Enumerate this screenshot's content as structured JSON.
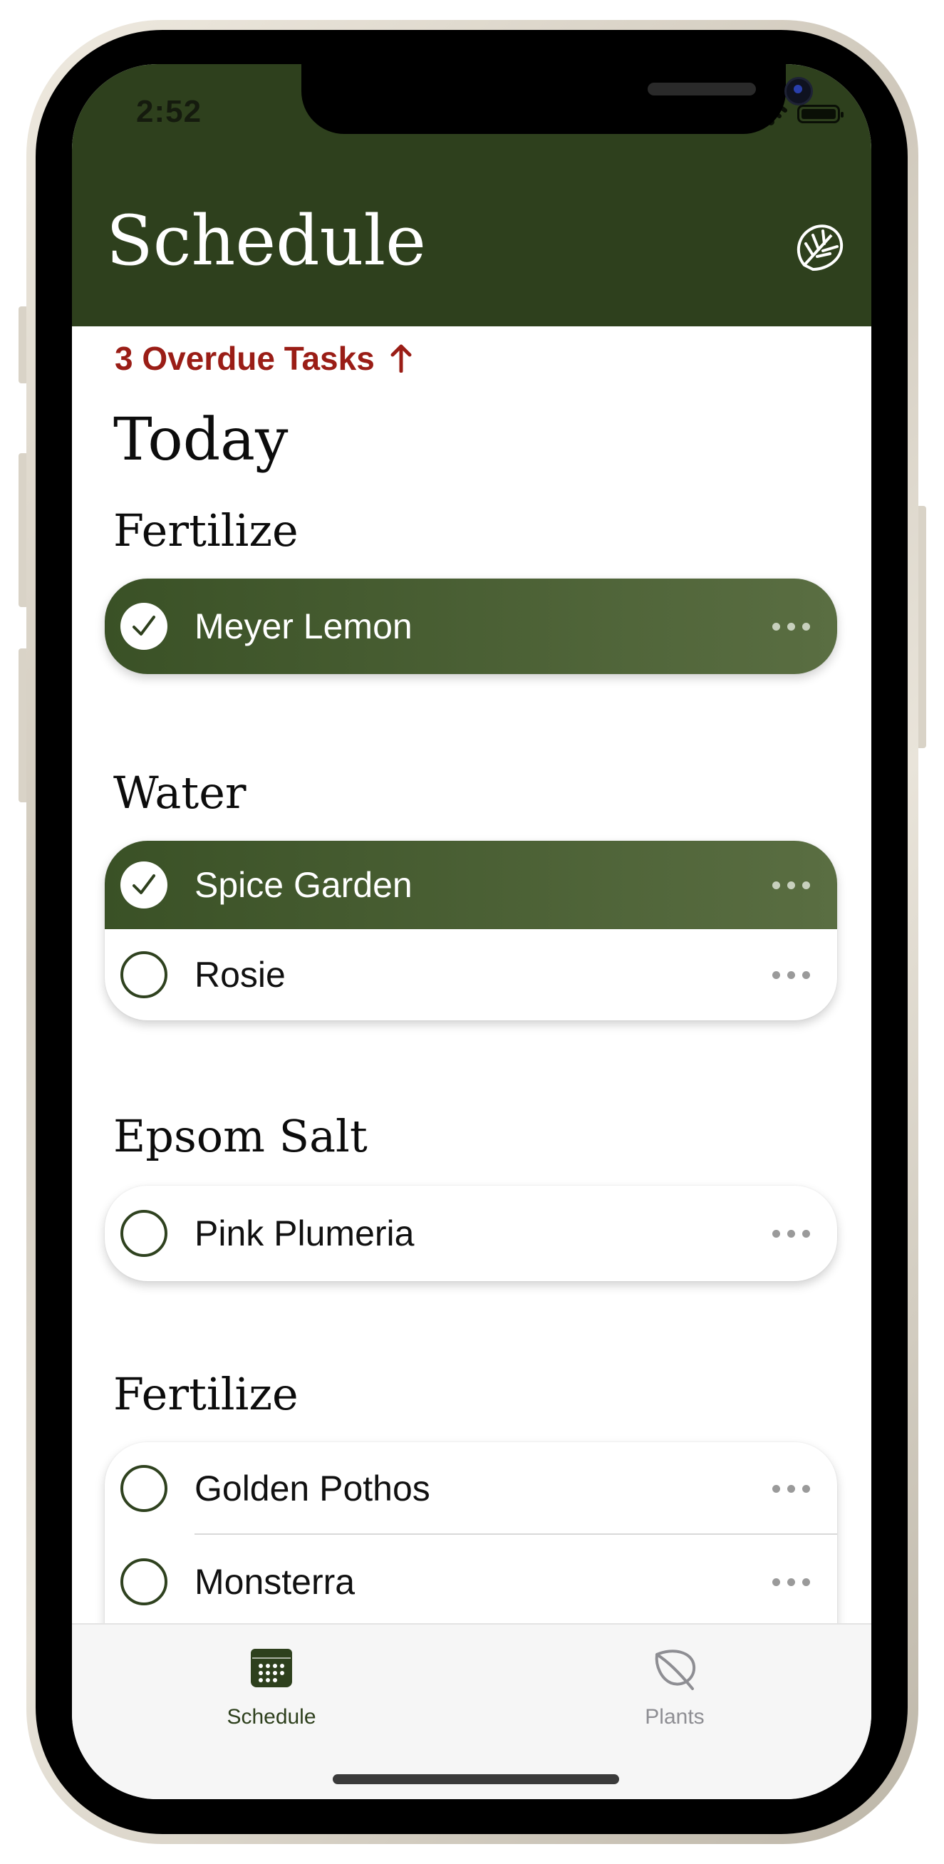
{
  "status_bar": {
    "time": "2:52"
  },
  "header": {
    "title": "Schedule",
    "logo_icon": "monstera-leaf-icon"
  },
  "overdue": {
    "label": "3 Overdue Tasks",
    "icon": "arrow-up-icon",
    "color": "#9a1d16"
  },
  "today_label": "Today",
  "groups": [
    {
      "title": "Fertilize",
      "items": [
        {
          "name": "Meyer Lemon",
          "done": true
        }
      ]
    },
    {
      "title": "Water",
      "items": [
        {
          "name": "Spice Garden",
          "done": true
        },
        {
          "name": "Rosie",
          "done": false
        }
      ]
    },
    {
      "title": "Epsom Salt",
      "items": [
        {
          "name": "Pink Plumeria",
          "done": false
        }
      ]
    },
    {
      "title": "Fertilize",
      "items": [
        {
          "name": "Golden Pothos",
          "done": false
        },
        {
          "name": "Monsterra",
          "done": false
        }
      ]
    }
  ],
  "tabs": [
    {
      "label": "Schedule",
      "icon": "calendar-icon",
      "active": true
    },
    {
      "label": "Plants",
      "icon": "leaf-icon",
      "active": false
    }
  ],
  "colors": {
    "brand_green": "#2e401d",
    "done_row": "#4a5f34",
    "tab_active": "#2e401d",
    "tab_inactive": "#8e8e93"
  }
}
